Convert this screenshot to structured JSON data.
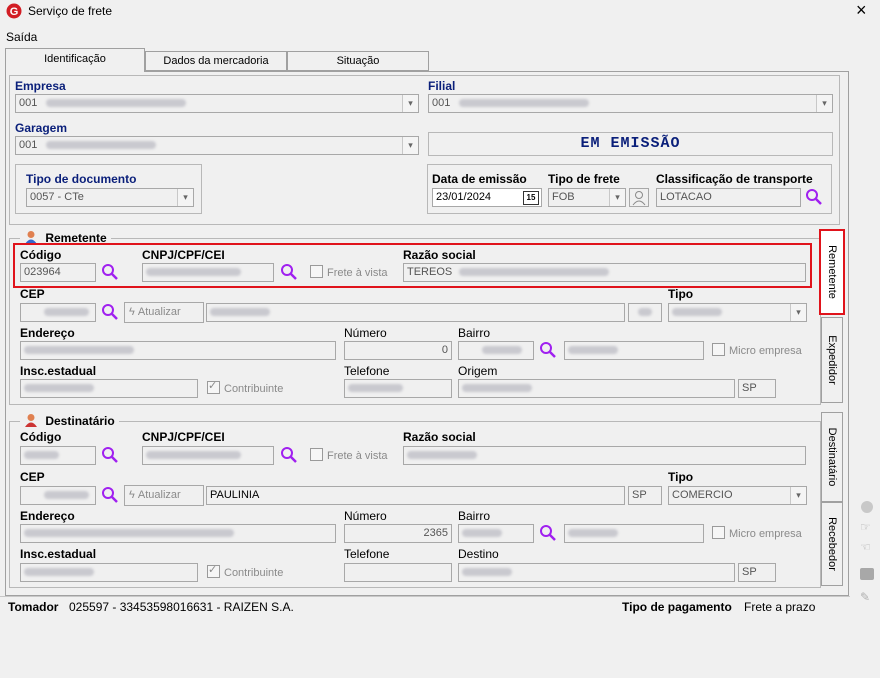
{
  "window": {
    "title": "Serviço de frete",
    "close_label": "×"
  },
  "menu": {
    "item": "Saída"
  },
  "tabs": [
    {
      "label": "Identificação"
    },
    {
      "label": "Dados da mercadoria"
    },
    {
      "label": "Situação"
    }
  ],
  "ident": {
    "empresa_label": "Empresa",
    "empresa_code": "001",
    "filial_label": "Filial",
    "filial_code": "001",
    "garagem_label": "Garagem",
    "garagem_code": "001",
    "status_text": "EM EMISSÃO",
    "tipo_doc_label": "Tipo de documento",
    "tipo_doc_value": "0057 - CTe",
    "data_emissao_label": "Data de emissão",
    "data_emissao_value": "23/01/2024",
    "calendar_label": "15",
    "tipo_frete_label": "Tipo de frete",
    "tipo_frete_value": "FOB",
    "classif_label": "Classificação de transporte",
    "classif_value": "LOTACAO"
  },
  "remetente": {
    "section_label": "Remetente",
    "codigo_label": "Código",
    "codigo_value": "023964",
    "cnpj_label": "CNPJ/CPF/CEI",
    "frete_vista_label": "Frete à vista",
    "razao_label": "Razão social",
    "razao_value": "TEREOS",
    "cep_label": "CEP",
    "atualizar_label": "Atualizar",
    "tipo_label": "Tipo",
    "endereco_label": "Endereço",
    "numero_label": "Número",
    "numero_value": "0",
    "bairro_label": "Bairro",
    "micro_label": "Micro empresa",
    "insc_label": "Insc.estadual",
    "contribuinte_label": "Contribuinte",
    "telefone_label": "Telefone",
    "origem_label": "Origem",
    "uf_value": "SP"
  },
  "destinatario": {
    "section_label": "Destinatário",
    "codigo_label": "Código",
    "cnpj_label": "CNPJ/CPF/CEI",
    "frete_vista_label": "Frete à vista",
    "razao_label": "Razão social",
    "cep_label": "CEP",
    "atualizar_label": "Atualizar",
    "cidade_value": "PAULINIA",
    "cidade_uf": "SP",
    "tipo_label": "Tipo",
    "tipo_value": "COMERCIO",
    "endereco_label": "Endereço",
    "numero_label": "Número",
    "numero_value": "2365",
    "bairro_label": "Bairro",
    "micro_label": "Micro empresa",
    "insc_label": "Insc.estadual",
    "contribuinte_label": "Contribuinte",
    "telefone_label": "Telefone",
    "destino_label": "Destino",
    "uf_value": "SP"
  },
  "side_tabs": [
    {
      "label": "Remetente"
    },
    {
      "label": "Expedidor"
    },
    {
      "label": "Destinatário"
    },
    {
      "label": "Recebedor"
    }
  ],
  "footer": {
    "tomador_label": "Tomador",
    "tomador_value": "025597 - 33453598016631 - RAIZEN S.A.",
    "pagamento_label": "Tipo de pagamento",
    "pagamento_value": "Frete a prazo"
  },
  "colors": {
    "accent_highlight": "#e0131b",
    "status_text": "#0a1f7a",
    "search_icon": "#a020f0"
  }
}
